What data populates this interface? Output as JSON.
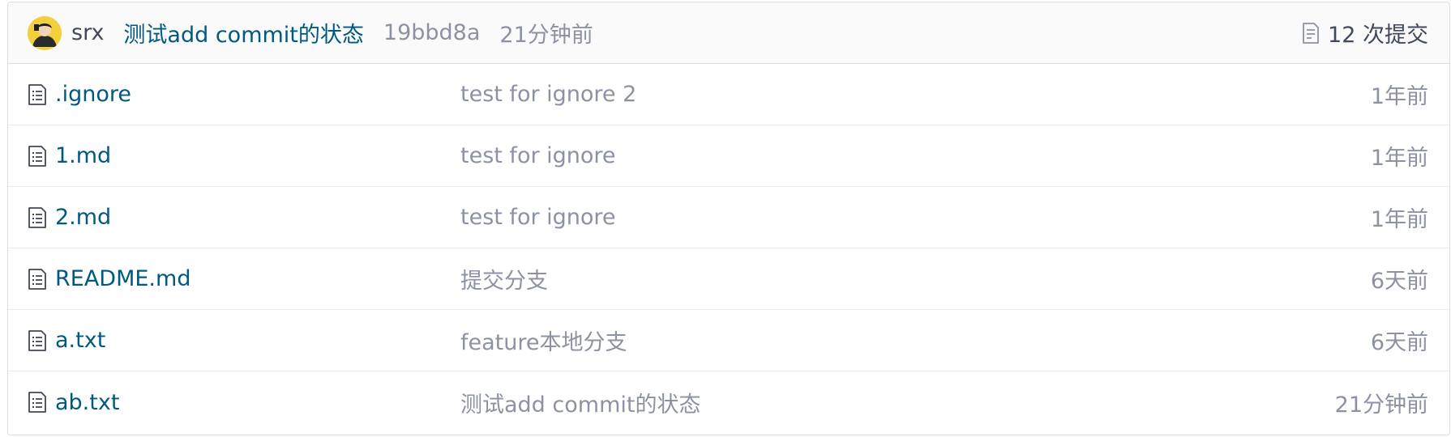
{
  "latest_commit": {
    "author": "srx",
    "message": "测试add commit的状态",
    "sha": "19bbd8a",
    "time": "21分钟前",
    "commits_count": "12 次提交",
    "commits_icon": "commit-list-icon",
    "avatar_icon": "user-avatar"
  },
  "files": [
    {
      "name": ".ignore",
      "message": "test for ignore 2",
      "time": "1年前",
      "icon": "file-icon"
    },
    {
      "name": "1.md",
      "message": "test for ignore",
      "time": "1年前",
      "icon": "file-icon"
    },
    {
      "name": "2.md",
      "message": "test for ignore",
      "time": "1年前",
      "icon": "file-icon"
    },
    {
      "name": "README.md",
      "message": "提交分支",
      "time": "6天前",
      "icon": "file-icon"
    },
    {
      "name": "a.txt",
      "message": "feature本地分支",
      "time": "6天前",
      "icon": "file-icon"
    },
    {
      "name": "ab.txt",
      "message": "测试add commit的状态",
      "time": "21分钟前",
      "icon": "file-icon"
    }
  ],
  "colors": {
    "link": "#005980",
    "muted": "#8c92a4",
    "text": "#40485b",
    "border": "#dedede",
    "header_bg": "#fafafa"
  }
}
